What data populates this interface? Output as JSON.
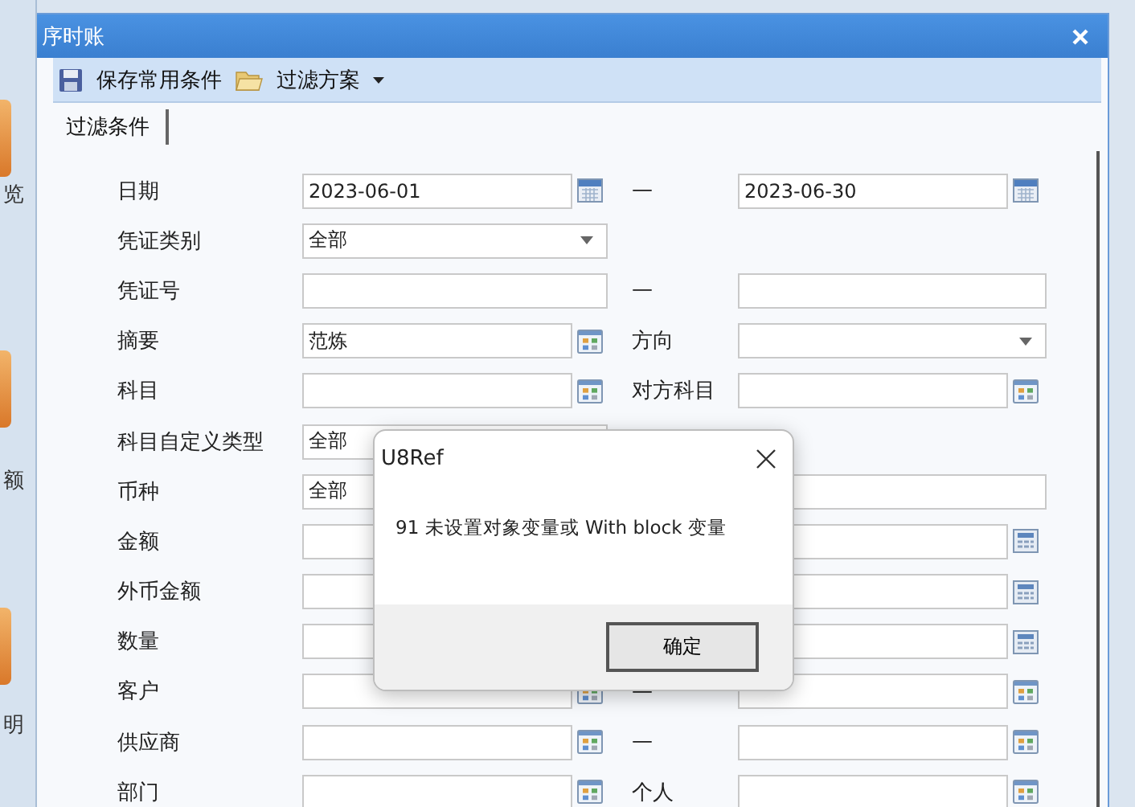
{
  "background": {
    "labels": [
      "览",
      "额",
      "明"
    ]
  },
  "window": {
    "title": "序时账"
  },
  "toolbar": {
    "save_label": "保存常用条件",
    "scheme_label": "过滤方案"
  },
  "tabs": [
    {
      "label": "过滤条件",
      "selected": true
    }
  ],
  "rows": [
    {
      "label": "日期",
      "from": {
        "kind": "date",
        "value": "2023-06-01"
      },
      "middle": "—",
      "to": {
        "kind": "date",
        "value": "2023-06-30"
      }
    },
    {
      "label": "凭证类别",
      "from": {
        "kind": "select",
        "value": "全部"
      }
    },
    {
      "label": "凭证号",
      "from": {
        "kind": "text"
      },
      "middle": "—",
      "to": {
        "kind": "text"
      }
    },
    {
      "label": "摘要",
      "from": {
        "kind": "ref",
        "value": "范炼"
      },
      "middle": "方向",
      "to": {
        "kind": "select"
      }
    },
    {
      "label": "科目",
      "from": {
        "kind": "ref"
      },
      "middle": "对方科目",
      "to": {
        "kind": "ref"
      }
    },
    {
      "label": "科目自定义类型",
      "from": {
        "kind": "text",
        "value": "全部"
      }
    },
    {
      "label": "币种",
      "from": {
        "kind": "text",
        "value": "全部"
      },
      "to": {
        "kind": "text"
      }
    },
    {
      "label": "金额",
      "from": {
        "kind": "text"
      },
      "to": {
        "kind": "calc"
      }
    },
    {
      "label": "外币金额",
      "from": {
        "kind": "text"
      },
      "to": {
        "kind": "calc"
      }
    },
    {
      "label": "数量",
      "from": {
        "kind": "text"
      },
      "to": {
        "kind": "calc"
      }
    },
    {
      "label": "客户",
      "from": {
        "kind": "ref"
      },
      "middle": "—",
      "to": {
        "kind": "ref"
      }
    },
    {
      "label": "供应商",
      "from": {
        "kind": "ref"
      },
      "middle": "—",
      "to": {
        "kind": "ref"
      }
    },
    {
      "label": "部门",
      "from": {
        "kind": "ref"
      },
      "middle": "个人",
      "to": {
        "kind": "ref"
      }
    }
  ],
  "message_box": {
    "title": "U8Ref",
    "message": "91 未设置对象变量或 With block 变量",
    "button": "确定"
  }
}
